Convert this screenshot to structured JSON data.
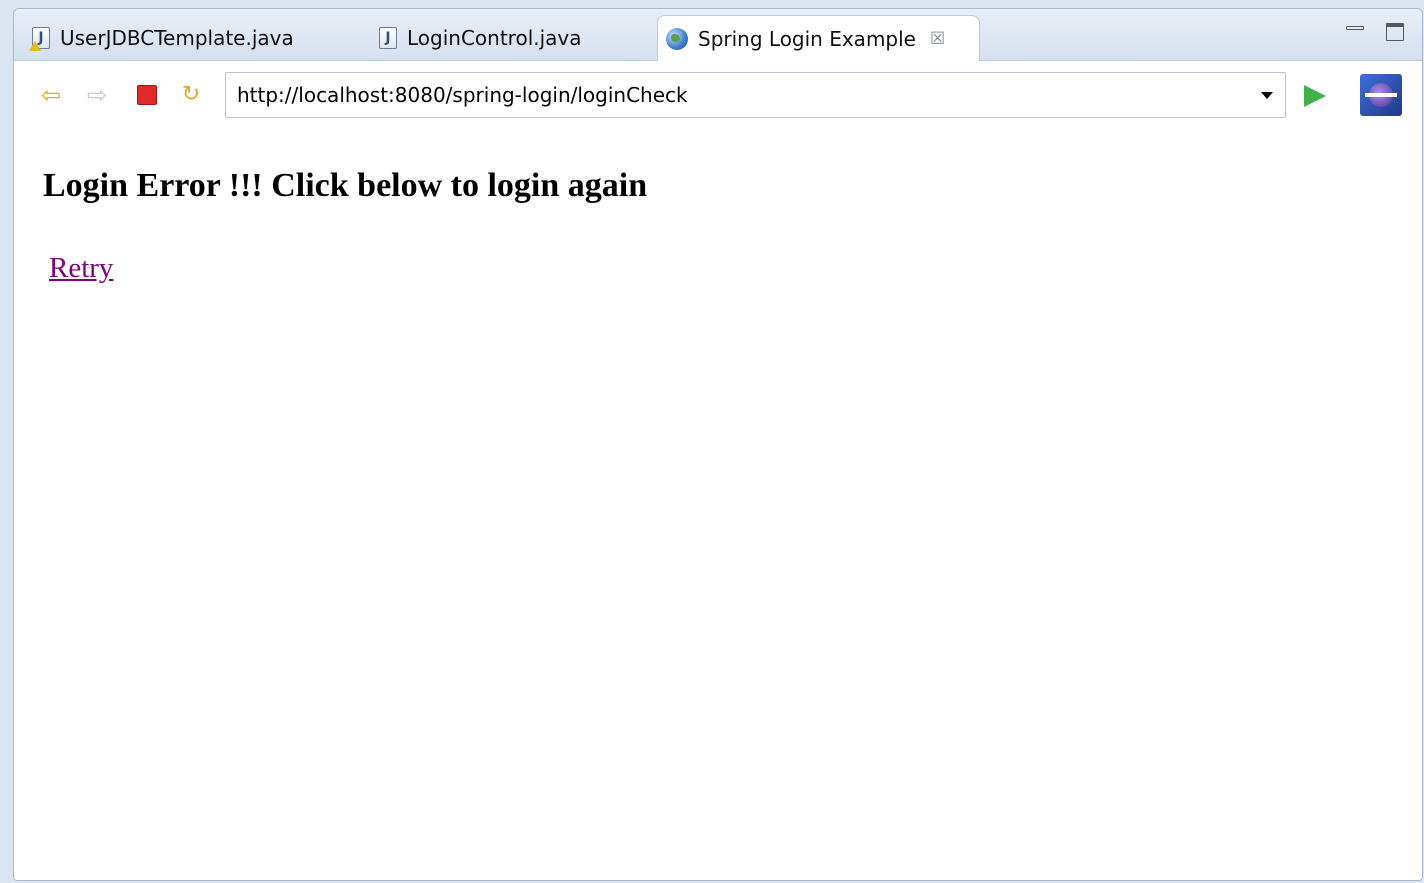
{
  "tabs": [
    {
      "label": "UserJDBCTemplate.java",
      "icon": "java-file-warning-icon",
      "active": false
    },
    {
      "label": "LoginControl.java",
      "icon": "java-file-icon",
      "active": false
    },
    {
      "label": "Spring Login Example",
      "icon": "globe-icon",
      "active": true
    }
  ],
  "toolbar": {
    "url": "http://localhost:8080/spring-login/loginCheck"
  },
  "page": {
    "heading": "Login Error !!! Click below to login again",
    "link_text": "Retry"
  },
  "colors": {
    "visited_link": "#800080",
    "stop": "#e02929",
    "go": "#3fb04a"
  }
}
